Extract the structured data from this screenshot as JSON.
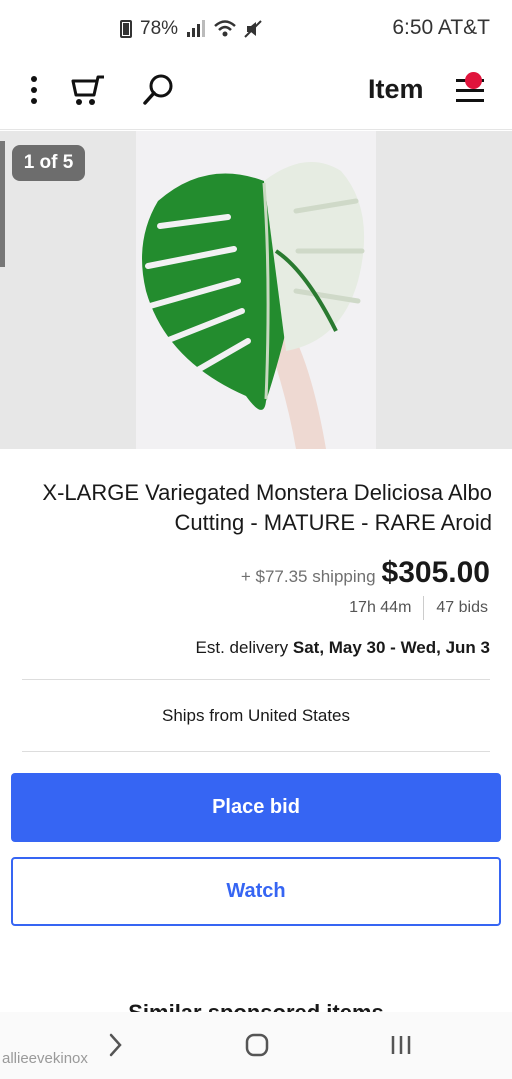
{
  "status_bar": {
    "time": "6:50 AT&T",
    "battery": "78%"
  },
  "header": {
    "title": "Item",
    "icons": [
      "more-icon",
      "cart-icon",
      "search-icon",
      "menu-icon"
    ]
  },
  "gallery": {
    "counter": "1 of 5"
  },
  "listing": {
    "title": "X-LARGE Variegated Monstera Deliciosa Albo Cutting - MATURE - RARE Aroid",
    "price": "$305.00",
    "shipping": "+ $77.35 shipping",
    "bids": "47 bids",
    "time_left": "17h 44m",
    "delivery_prefix": "Est. delivery",
    "delivery_dates": "Sat, May 30 - Wed, Jun 3",
    "ships_from": "Ships from United States"
  },
  "actions": {
    "place_bid": "Place bid",
    "watch": "Watch"
  },
  "similar": {
    "heading": "Similar sponsored items"
  },
  "watermark": "allieevekinox",
  "colors": {
    "primary": "#3665f3",
    "notification": "#e0143c",
    "leaf": "#1f8a2e"
  }
}
